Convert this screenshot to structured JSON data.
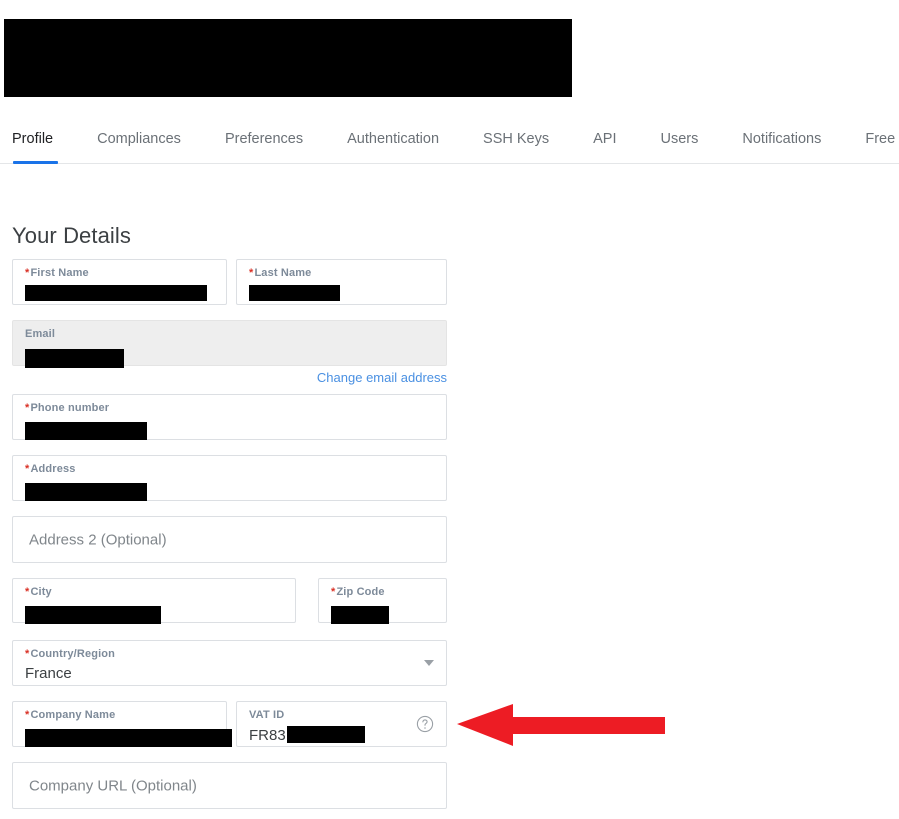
{
  "banner": {
    "redacted": true,
    "label": "redacted-account-header"
  },
  "tabs": [
    {
      "label": "Profile",
      "active": true
    },
    {
      "label": "Compliances",
      "active": false
    },
    {
      "label": "Preferences",
      "active": false
    },
    {
      "label": "Authentication",
      "active": false
    },
    {
      "label": "SSH Keys",
      "active": false
    },
    {
      "label": "API",
      "active": false
    },
    {
      "label": "Users",
      "active": false
    },
    {
      "label": "Notifications",
      "active": false
    },
    {
      "label": "Free Tier Program",
      "active": false
    }
  ],
  "page": {
    "title": "Your Details"
  },
  "form": {
    "first_name": {
      "label": "First Name",
      "required": true,
      "value": "",
      "redacted": true,
      "placeholder": ""
    },
    "last_name": {
      "label": "Last Name",
      "required": true,
      "value": "",
      "redacted": true,
      "placeholder": ""
    },
    "email": {
      "label": "Email",
      "required": false,
      "value": "",
      "redacted": true,
      "placeholder": "",
      "disabled": true
    },
    "change_email_link": "Change email address",
    "phone": {
      "label": "Phone number",
      "required": true,
      "value": "",
      "redacted": true,
      "placeholder": ""
    },
    "address": {
      "label": "Address",
      "required": true,
      "value": "",
      "redacted": true,
      "placeholder": ""
    },
    "address2": {
      "label": "",
      "required": false,
      "value": "",
      "redacted": false,
      "placeholder": "Address 2 (Optional)"
    },
    "city": {
      "label": "City",
      "required": true,
      "value": "",
      "redacted": true,
      "placeholder": ""
    },
    "zip": {
      "label": "Zip Code",
      "required": true,
      "value": "",
      "redacted": true,
      "placeholder": ""
    },
    "country": {
      "label": "Country/Region",
      "required": true,
      "value": "France",
      "redacted": false,
      "placeholder": ""
    },
    "company_name": {
      "label": "Company Name",
      "required": true,
      "value": "",
      "redacted": true,
      "placeholder": ""
    },
    "vat_id": {
      "label": "VAT ID",
      "required": false,
      "value": "FR83",
      "redacted": true,
      "placeholder": ""
    },
    "company_url": {
      "label": "",
      "required": false,
      "value": "",
      "redacted": false,
      "placeholder": "Company URL (Optional)"
    }
  },
  "icons": {
    "dropdown_caret": "chevron-down-icon",
    "vat_help": "help-circle-icon"
  },
  "annotation": {
    "type": "arrow",
    "direction": "left",
    "color": "#ED1C24",
    "points_to": "vat-id-field"
  },
  "colors": {
    "accent": "#1a73e8",
    "link": "#4a90e2",
    "required_asterisk": "#d93025",
    "label_text": "#7d8a99",
    "field_border": "#dcdfe3",
    "disabled_bg": "#eeeeee",
    "arrow_red": "#ED1C24"
  }
}
